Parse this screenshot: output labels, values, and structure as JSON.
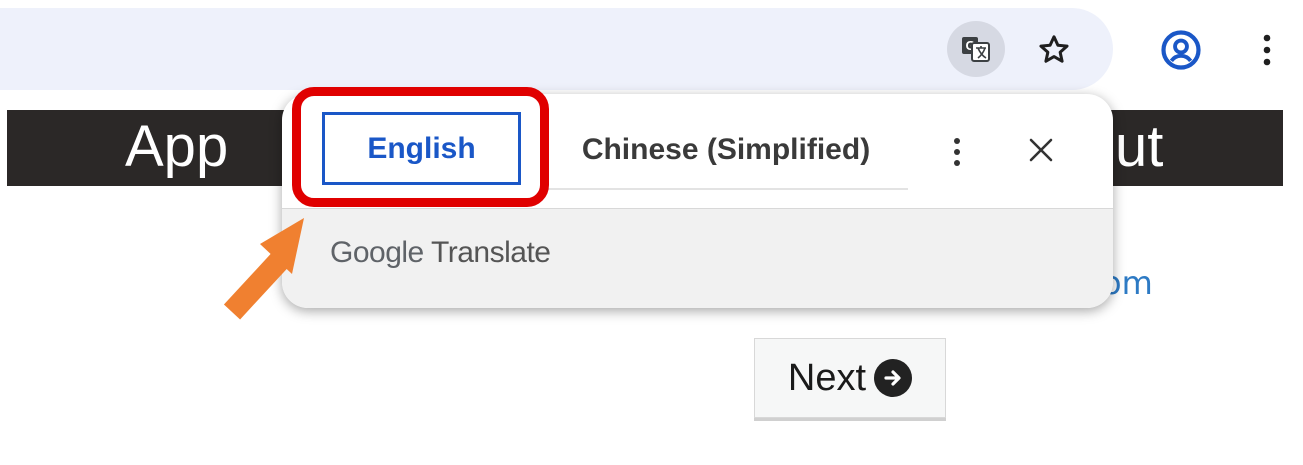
{
  "toolbar": {
    "translate_icon": "google-translate-icon",
    "star_icon": "star-outline-icon",
    "profile_icon": "account-circle-icon",
    "menu_icon": "vertical-ellipsis-icon"
  },
  "page": {
    "header_left": "App",
    "header_right": "ut",
    "link_fragment": "om",
    "next_button_label": "Next",
    "next_icon": "arrow-circle-right-icon"
  },
  "translate_popup": {
    "languages": [
      "English",
      "Chinese (Simplified)"
    ],
    "selected_language": "English",
    "brand_google": "Google",
    "brand_translate": "Translate",
    "more_icon": "vertical-ellipsis-icon",
    "close_icon": "close-icon"
  },
  "colors": {
    "highlight": "#e00000",
    "arrow": "#f08030",
    "accent_blue": "#1a57c7",
    "header_bg": "#2b2827"
  }
}
